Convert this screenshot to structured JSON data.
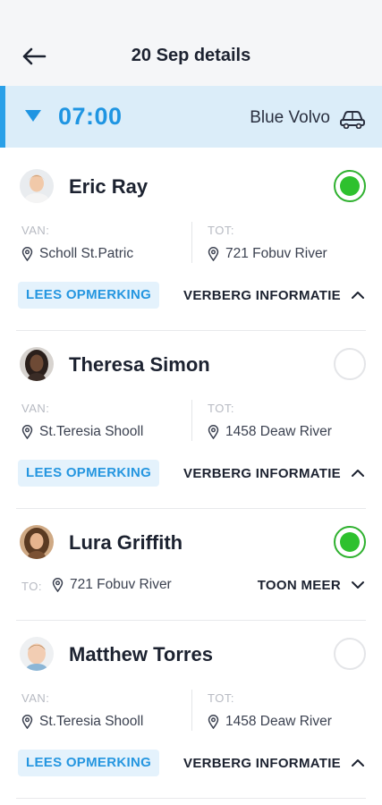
{
  "header": {
    "title": "20 Sep details"
  },
  "trip": {
    "time": "07:00",
    "vehicle": "Blue Volvo"
  },
  "colors": {
    "accent": "#1f95e2",
    "check": "#2ec12e"
  },
  "passengers": [
    {
      "name": "Eric Ray",
      "checked": true,
      "from_label": "VAN:",
      "from": "Scholl St.Patric",
      "to_label": "TOT:",
      "to": "721 Fobuv River",
      "note_label": "LEES OPMERKING",
      "toggle_label": "VERBERG INFORMATIE"
    },
    {
      "name": "Theresa Simon",
      "checked": false,
      "from_label": "VAN:",
      "from": "St.Teresia Shooll",
      "to_label": "TOT:",
      "to": "1458 Deaw River",
      "note_label": "LEES OPMERKING",
      "toggle_label": "VERBERG INFORMATIE"
    },
    {
      "name": "Lura Griffith",
      "checked": true,
      "to_label": "TO:",
      "to": "721 Fobuv River",
      "toggle_label": "TOON MEER"
    },
    {
      "name": "Matthew Torres",
      "checked": false,
      "from_label": "VAN:",
      "from": "St.Teresia Shooll",
      "to_label": "TOT:",
      "to": "1458 Deaw River",
      "note_label": "LEES OPMERKING",
      "toggle_label": "VERBERG INFORMATIE"
    }
  ]
}
